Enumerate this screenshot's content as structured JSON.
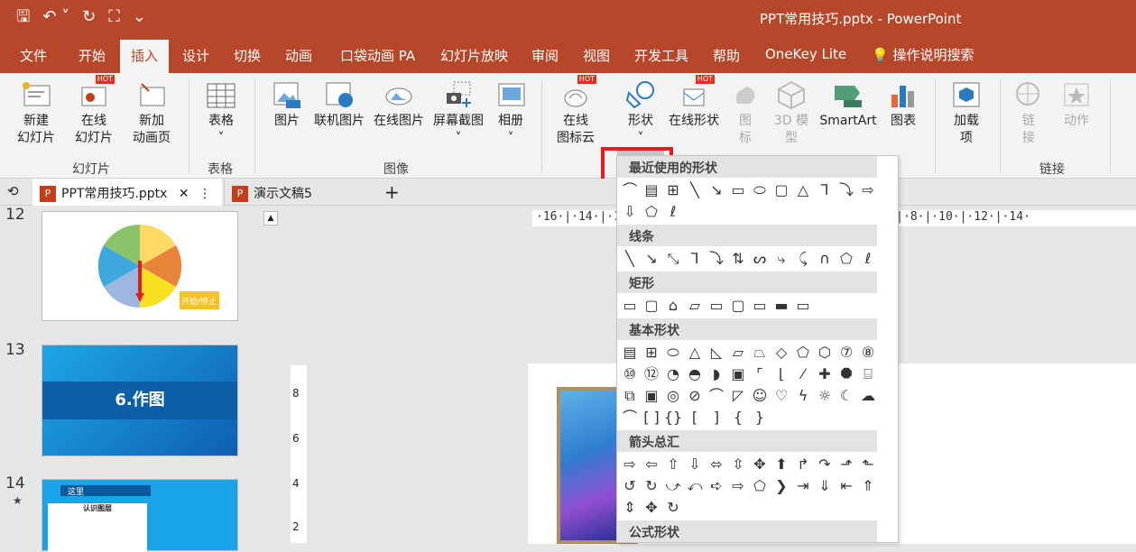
{
  "window": {
    "title": "PPT常用技巧.pptx  -  PowerPoint"
  },
  "qat": {
    "save_icon": "save-icon",
    "undo_icon": "undo-icon",
    "redo_icon": "redo-icon",
    "present_icon": "present-icon"
  },
  "tabs": [
    "文件",
    "开始",
    "插入",
    "设计",
    "切换",
    "动画",
    "口袋动画 PA",
    "幻灯片放映",
    "审阅",
    "视图",
    "开发工具",
    "帮助",
    "OneKey Lite"
  ],
  "tellme": "操作说明搜索",
  "ribbon": {
    "new_slide": "新建\n幻灯片",
    "online_slide": "在线\n幻灯片",
    "new_anim": "新加\n动画页",
    "group_slides": "幻灯片",
    "table": "表格",
    "group_table": "表格",
    "picture": "图片",
    "online_picture": "联机图片",
    "online_picture2": "在线图片",
    "screenshot": "屏幕截图",
    "album": "相册",
    "group_image": "图像",
    "icon_cloud": "在线\n图标云",
    "shapes": "形状",
    "online_shapes": "在线形状",
    "icons": "图\n标",
    "model3d": "3D 模\n型",
    "smartart": "SmartArt",
    "chart": "图表",
    "addins": "加载\n项",
    "link": "链\n接",
    "action": "动作",
    "group_links": "链接",
    "hot": "HOT"
  },
  "doctabs": [
    {
      "label": "PPT常用技巧.pptx"
    },
    {
      "label": "演示文稿5"
    }
  ],
  "thumbs": [
    {
      "num": "12",
      "label": "开始/停止"
    },
    {
      "num": "13",
      "label": "6.作图"
    },
    {
      "num": "14",
      "title": "这里",
      "sub": "认识图层"
    }
  ],
  "gallery": {
    "recent": "最近使用的形状",
    "lines": "线条",
    "rect": "矩形",
    "basic": "基本形状",
    "arrows": "箭头总汇",
    "formula": "公式形状"
  },
  "ruler_h": "·16·|·14·|·12·|·10·|·8·|·6·|·4·|·2·|·0·|·2·|·4·|·6·|·8·|·10·|·12·|·14·",
  "colors": {
    "accent": "#b7472a",
    "highlight": "#e02020"
  }
}
